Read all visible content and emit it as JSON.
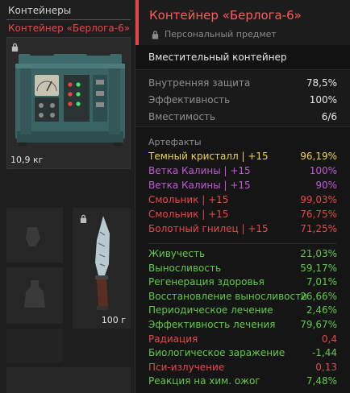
{
  "left": {
    "title": "Контейнеры",
    "subtitle": "Контейнер «Берлога-6»",
    "container_weight": "10,9 кг",
    "knife_weight": "100 г"
  },
  "tooltip": {
    "title": "Контейнер «Берлога-6»",
    "subtitle": "Персональный предмет",
    "description": "Вместительный контейнер",
    "stats": [
      {
        "label": "Внутренняя защита",
        "value": "78,5%"
      },
      {
        "label": "Эффективность",
        "value": "100%"
      },
      {
        "label": "Вместимость",
        "value": "6/6"
      }
    ],
    "artifacts_label": "Артефакты",
    "artifacts": [
      {
        "label": "Темный кристалл | +15",
        "value": "96,19%",
        "color": "#f0d24a"
      },
      {
        "label": "Ветка Калины | +15",
        "value": "100%",
        "color": "#c15ad6"
      },
      {
        "label": "Ветка Калины | +15",
        "value": "90%",
        "color": "#c15ad6"
      },
      {
        "label": "Смольник | +15",
        "value": "99,03%",
        "color": "#e8474a"
      },
      {
        "label": "Смольник | +15",
        "value": "76,75%",
        "color": "#e8474a"
      },
      {
        "label": "Болотный гнилец | +15",
        "value": "71,25%",
        "color": "#e8474a"
      }
    ],
    "effects": [
      {
        "label": "Живучесть",
        "value": "21,03%",
        "color": "#62c947"
      },
      {
        "label": "Выносливость",
        "value": "59,17%",
        "color": "#62c947"
      },
      {
        "label": "Регенерация здоровья",
        "value": "7,01%",
        "color": "#62c947"
      },
      {
        "label": "Восстановление выносливости",
        "value": "26,66%",
        "color": "#62c947"
      },
      {
        "label": "Периодическое лечение",
        "value": "2,46%",
        "color": "#62c947"
      },
      {
        "label": "Эффективность лечения",
        "value": "79,67%",
        "color": "#62c947"
      },
      {
        "label": "Радиация",
        "value": "0,4",
        "color": "#e8474a"
      },
      {
        "label": "Биологическое заражение",
        "value": "-1,44",
        "color": "#62c947"
      },
      {
        "label": "Пси-излучение",
        "value": "0,13",
        "color": "#e8474a"
      },
      {
        "label": "Реакция на хим. ожог",
        "value": "7,48%",
        "color": "#62c947"
      }
    ]
  }
}
